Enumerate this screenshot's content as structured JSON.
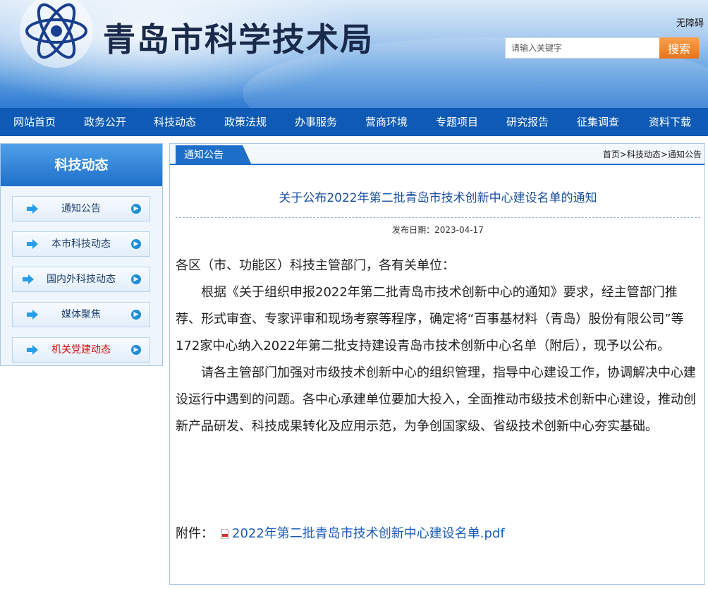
{
  "header": {
    "site_title": "青岛市科学技术局",
    "accessibility_label": "无障碍",
    "search_placeholder": "请输入关键字",
    "search_button": "搜索"
  },
  "nav": {
    "items": [
      "网站首页",
      "政务公开",
      "科技动态",
      "政策法规",
      "办事服务",
      "营商环境",
      "专题项目",
      "研究报告",
      "征集调查",
      "资料下载"
    ]
  },
  "sidebar": {
    "title": "科技动态",
    "items": [
      {
        "label": "通知公告"
      },
      {
        "label": "本市科技动态"
      },
      {
        "label": "国内外科技动态"
      },
      {
        "label": "媒体聚焦"
      },
      {
        "label": "机关党建动态"
      }
    ]
  },
  "main": {
    "tab_label": "通知公告",
    "breadcrumb": "首页>科技动态>通知公告",
    "article_title": "关于公布2022年第二批青岛市技术创新中心建设名单的通知",
    "date_label": "发布日期：",
    "date_value": "2023-04-17",
    "salutation": "各区（市、功能区）科技主管部门，各有关单位：",
    "paragraph1": "根据《关于组织申报2022年第二批青岛市技术创新中心的通知》要求，经主管部门推荐、形式审查、专家评审和现场考察等程序，确定将“百事基材料（青岛）股份有限公司”等172家中心纳入2022年第二批支持建设青岛市技术创新中心名单（附后），现予以公布。",
    "paragraph2": "请各主管部门加强对市级技术创新中心的组织管理，指导中心建设工作，协调解决中心建设运行中遇到的问题。各中心承建单位要加大投入，全面推动市级技术创新中心建设，推动创新产品研发、科技成果转化及应用示范，为争创国家级、省级技术创新中心夯实基础。",
    "attachment_label": "附件：",
    "attachment_link": "2022年第二批青岛市技术创新中心建设名单.pdf"
  },
  "colors": {
    "nav_bg": "#0e5ab4",
    "accent": "#1e6fc9",
    "search_button": "#e8731a",
    "link": "#1b5cb8",
    "sidebar_highlight": "#d01010"
  }
}
